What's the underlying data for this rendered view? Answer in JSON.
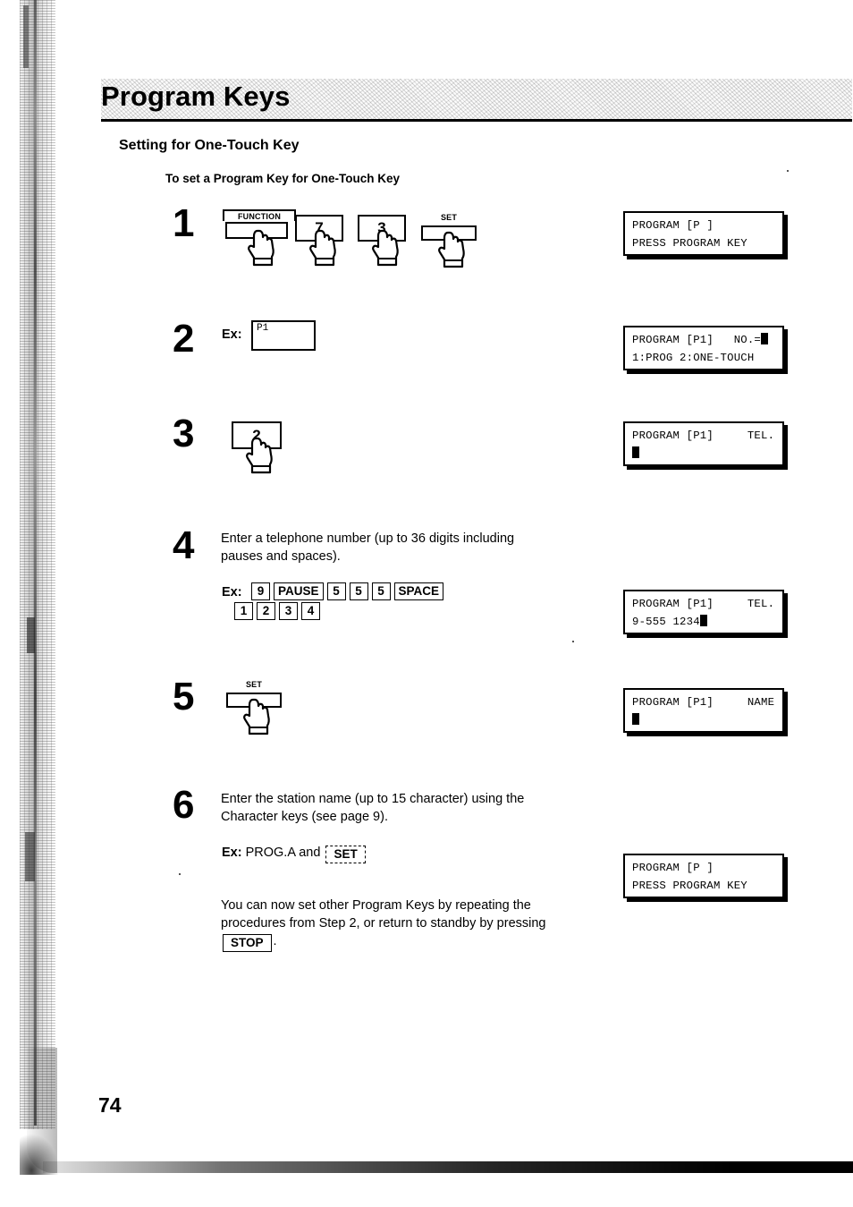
{
  "page": {
    "title": "Program Keys",
    "section_title": "Setting for One-Touch Key",
    "sub_title": "To set a Program Key for One-Touch Key",
    "page_number": "74"
  },
  "steps": [
    {
      "number": "1",
      "keys": [
        {
          "label": "FUNCTION",
          "type": "caption-key-boxed"
        },
        {
          "label": "7",
          "type": "number-key"
        },
        {
          "label": "3",
          "type": "number-key"
        },
        {
          "label": "SET",
          "type": "caption-key"
        }
      ]
    },
    {
      "number": "2",
      "ex_label": "Ex:",
      "display_value": "P1"
    },
    {
      "number": "3",
      "keys": [
        {
          "label": "2",
          "type": "number-key"
        }
      ]
    },
    {
      "number": "4",
      "instruction_line1": "Enter a telephone number (up to 36 digits including",
      "instruction_line2": "pauses and spaces).",
      "ex_label": "Ex:",
      "ex_keys_row1": [
        "9",
        "PAUSE",
        "5",
        "5",
        "5",
        "SPACE"
      ],
      "ex_keys_row2": [
        "1",
        "2",
        "3",
        "4"
      ]
    },
    {
      "number": "5",
      "keys": [
        {
          "label": "SET",
          "type": "caption-key"
        }
      ]
    },
    {
      "number": "6",
      "instruction_line1": "Enter the station name (up to 15 character) using the",
      "instruction_line2": "Character keys (see page 9).",
      "ex_label": "Ex:",
      "ex_text_before": "PROG.A and",
      "ex_key": "SET"
    }
  ],
  "closing": {
    "line1": "You can now set other Program Keys by repeating the",
    "line2": "procedures from Step 2, or return to standby by pressing",
    "stop_key": "STOP",
    "line3_suffix": "."
  },
  "displays": [
    {
      "line1": "PROGRAM [P ]",
      "line2": "PRESS PROGRAM KEY",
      "caret": "none"
    },
    {
      "line1": "PROGRAM [P1]   NO.=",
      "line2": "1:PROG 2:ONE-TOUCH",
      "caret": "line1-end"
    },
    {
      "line1": "PROGRAM [P1]     TEL.",
      "line2": "",
      "caret": "line2-start"
    },
    {
      "line1": "PROGRAM [P1]     TEL.",
      "line2": "9-555 1234",
      "caret": "line2-end"
    },
    {
      "line1": "PROGRAM [P1]     NAME",
      "line2": "",
      "caret": "line2-start"
    },
    {
      "line1": "PROGRAM [P ]",
      "line2": "PRESS PROGRAM KEY",
      "caret": "none"
    }
  ]
}
